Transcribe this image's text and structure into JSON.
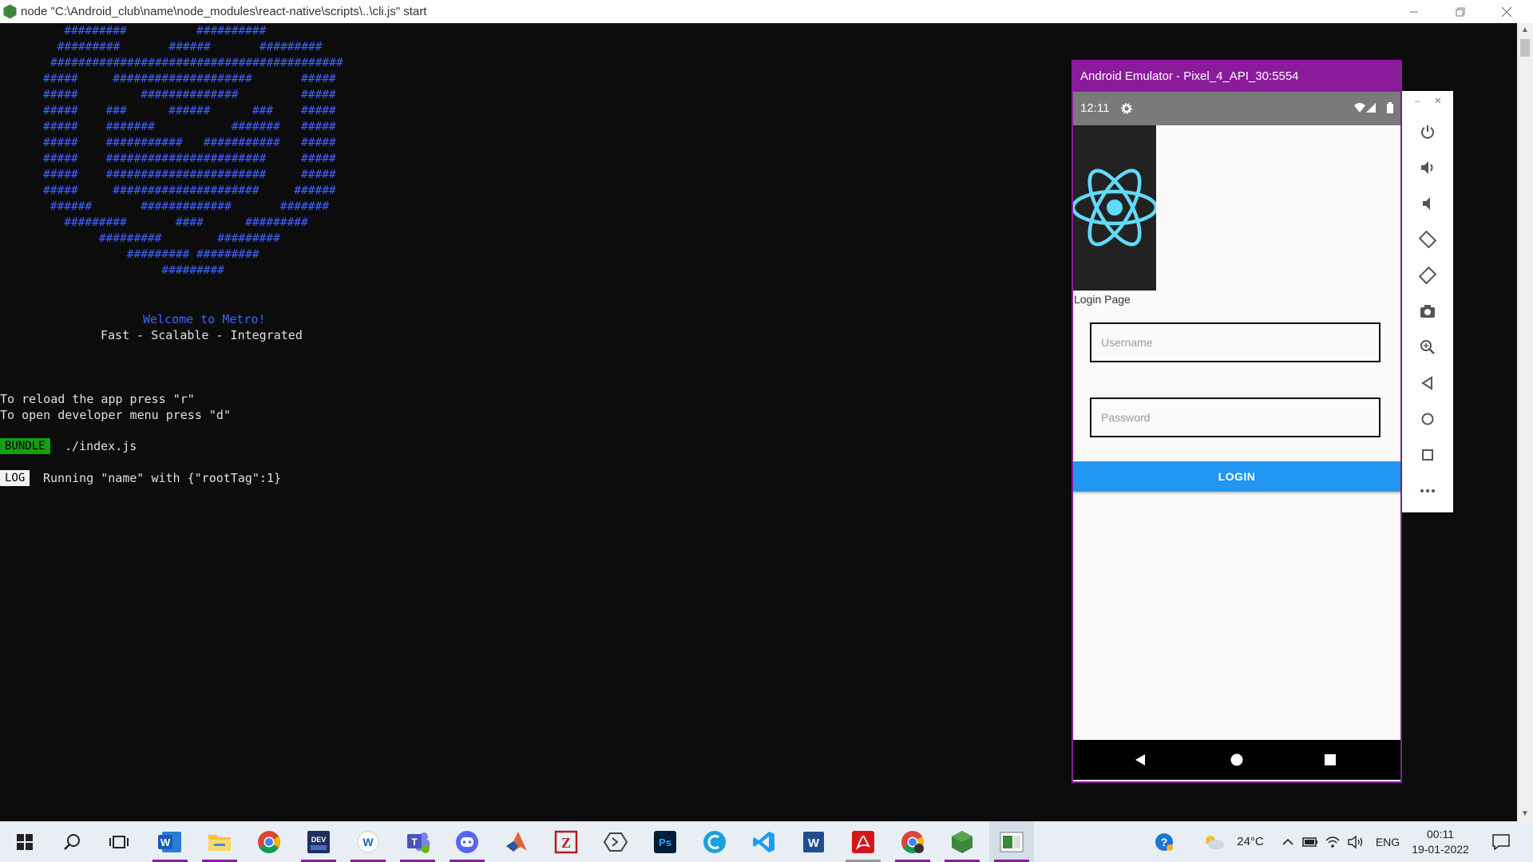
{
  "window": {
    "title": "node  \"C:\\Android_club\\name\\node_modules\\react-native\\scripts\\..\\cli.js\" start",
    "minimize_icon": "minimize-icon",
    "restore_icon": "restore-icon",
    "close_icon": "close-icon"
  },
  "console": {
    "logo_lines": [
      "   #########          ##########",
      " #########       ######       #########",
      "##########################################",
      "#####     ####################       #####",
      "#####         ##############         #####",
      "#####    ###      ######      ###    #####",
      "#####    #######           #######   #####",
      "#####    ###########   ###########   #####",
      "#####    #######################     #####",
      "#####    #######################     #####",
      "#####     #####################     ######",
      " ######       #############       #######",
      "   #########       ####      #########",
      "        #########        #########",
      "            ######### #########",
      "                 #########"
    ],
    "welcome": "Welcome to Metro!",
    "tagline": "Fast - Scalable - Integrated",
    "reload_hint": "To reload the app press \"r\"",
    "devmenu_hint": "To open developer menu press \"d\"",
    "bundle_tag": "BUNDLE",
    "bundle_file": "./index.js",
    "log_tag": "LOG",
    "log_message": "Running \"name\" with {\"rootTag\":1}"
  },
  "emulator": {
    "title": "Android Emulator - Pixel_4_API_30:5554",
    "status_time": "12:11",
    "app": {
      "page_label": "Login Page",
      "username_placeholder": "Username",
      "password_placeholder": "Password",
      "login_button": "LOGIN"
    },
    "toolbar": [
      "power-icon",
      "volume-up-icon",
      "volume-down-icon",
      "rotate-left-icon",
      "rotate-right-icon",
      "camera-icon",
      "zoom-icon",
      "back-icon",
      "home-icon",
      "overview-icon",
      "more-icon"
    ]
  },
  "taskbar": {
    "apps": [
      "start-icon",
      "search-icon",
      "task-view-icon",
      "word-icon",
      "file-explorer-icon",
      "chrome-icon",
      "dev-icon",
      "w-app-icon",
      "teams-icon",
      "discord-icon",
      "matlab-icon",
      "filezilla-icon",
      "arduino-icon",
      "photoshop-icon",
      "c-app-icon",
      "vscode-icon",
      "w-editor-icon",
      "acrobat-icon",
      "chrome-dev-icon",
      "nodejs-icon",
      "terminal-icon"
    ],
    "temperature": "24°C",
    "language": "ENG",
    "time": "00:11",
    "date": "19-01-2022"
  }
}
